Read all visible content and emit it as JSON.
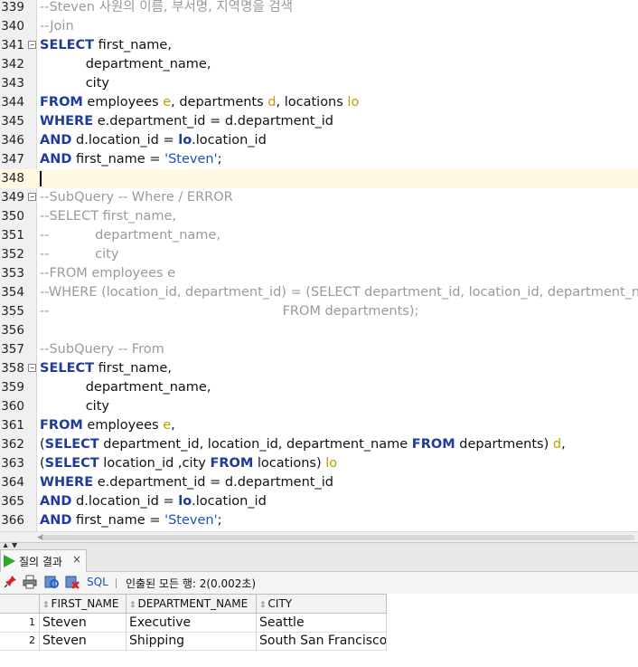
{
  "editor": {
    "lines": [
      {
        "num": "339",
        "fold": false,
        "tokens": [
          {
            "t": "--Steven 사원의 이름, 부서명, 지역명을 검색",
            "c": "cm"
          }
        ]
      },
      {
        "num": "340",
        "fold": false,
        "tokens": [
          {
            "t": "--Join",
            "c": "cm"
          }
        ]
      },
      {
        "num": "341",
        "fold": true,
        "tokens": [
          {
            "t": "SELECT",
            "c": "kw"
          },
          {
            "t": " first_name,",
            "c": ""
          }
        ]
      },
      {
        "num": "342",
        "fold": false,
        "tokens": [
          {
            "t": "           department_name,",
            "c": ""
          }
        ]
      },
      {
        "num": "343",
        "fold": false,
        "tokens": [
          {
            "t": "           city",
            "c": ""
          }
        ]
      },
      {
        "num": "344",
        "fold": false,
        "tokens": [
          {
            "t": "FROM",
            "c": "kw"
          },
          {
            "t": " employees ",
            "c": ""
          },
          {
            "t": "e",
            "c": "al"
          },
          {
            "t": ", departments ",
            "c": ""
          },
          {
            "t": "d",
            "c": "al"
          },
          {
            "t": ", locations ",
            "c": ""
          },
          {
            "t": "lo",
            "c": "al"
          }
        ]
      },
      {
        "num": "345",
        "fold": false,
        "tokens": [
          {
            "t": "WHERE",
            "c": "kw"
          },
          {
            "t": " e.department_id = d.department_id",
            "c": ""
          }
        ]
      },
      {
        "num": "346",
        "fold": false,
        "tokens": [
          {
            "t": "AND",
            "c": "kw"
          },
          {
            "t": " d.location_id = ",
            "c": ""
          },
          {
            "t": "lo",
            "c": "kw"
          },
          {
            "t": ".location_id",
            "c": ""
          }
        ]
      },
      {
        "num": "347",
        "fold": false,
        "tokens": [
          {
            "t": "AND",
            "c": "kw"
          },
          {
            "t": " first_name = ",
            "c": ""
          },
          {
            "t": "'Steven'",
            "c": "str"
          },
          {
            "t": ";",
            "c": ""
          }
        ]
      },
      {
        "num": "348",
        "fold": false,
        "current": true,
        "tokens": []
      },
      {
        "num": "349",
        "fold": true,
        "tokens": [
          {
            "t": "--SubQuery -- Where / ERROR",
            "c": "cm"
          }
        ]
      },
      {
        "num": "350",
        "fold": false,
        "tokens": [
          {
            "t": "--SELECT first_name,",
            "c": "cm"
          }
        ]
      },
      {
        "num": "351",
        "fold": false,
        "tokens": [
          {
            "t": "--           department_name,",
            "c": "cm"
          }
        ]
      },
      {
        "num": "352",
        "fold": false,
        "tokens": [
          {
            "t": "--           city",
            "c": "cm"
          }
        ]
      },
      {
        "num": "353",
        "fold": false,
        "tokens": [
          {
            "t": "--FROM employees e",
            "c": "cm"
          }
        ]
      },
      {
        "num": "354",
        "fold": false,
        "tokens": [
          {
            "t": "--WHERE (location_id, department_id) = (SELECT department_id, location_id, department_name",
            "c": "cm"
          }
        ]
      },
      {
        "num": "355",
        "fold": false,
        "tokens": [
          {
            "t": "--                                                        FROM departments);",
            "c": "cm"
          }
        ]
      },
      {
        "num": "356",
        "fold": false,
        "tokens": []
      },
      {
        "num": "357",
        "fold": false,
        "tokens": [
          {
            "t": "--SubQuery -- From",
            "c": "cm"
          }
        ]
      },
      {
        "num": "358",
        "fold": true,
        "tokens": [
          {
            "t": "SELECT",
            "c": "kw"
          },
          {
            "t": " first_name,",
            "c": ""
          }
        ]
      },
      {
        "num": "359",
        "fold": false,
        "tokens": [
          {
            "t": "           department_name,",
            "c": ""
          }
        ]
      },
      {
        "num": "360",
        "fold": false,
        "tokens": [
          {
            "t": "           city",
            "c": ""
          }
        ]
      },
      {
        "num": "361",
        "fold": false,
        "tokens": [
          {
            "t": "FROM",
            "c": "kw"
          },
          {
            "t": " employees ",
            "c": ""
          },
          {
            "t": "e",
            "c": "al"
          },
          {
            "t": ",",
            "c": ""
          }
        ]
      },
      {
        "num": "362",
        "fold": false,
        "tokens": [
          {
            "t": "(",
            "c": ""
          },
          {
            "t": "SELECT",
            "c": "kw"
          },
          {
            "t": " department_id, location_id, department_name ",
            "c": ""
          },
          {
            "t": "FROM",
            "c": "kw"
          },
          {
            "t": " departments) ",
            "c": ""
          },
          {
            "t": "d",
            "c": "al"
          },
          {
            "t": ",",
            "c": ""
          }
        ]
      },
      {
        "num": "363",
        "fold": false,
        "tokens": [
          {
            "t": "(",
            "c": ""
          },
          {
            "t": "SELECT",
            "c": "kw"
          },
          {
            "t": " location_id ,city ",
            "c": ""
          },
          {
            "t": "FROM",
            "c": "kw"
          },
          {
            "t": " locations) ",
            "c": ""
          },
          {
            "t": "lo",
            "c": "al"
          }
        ]
      },
      {
        "num": "364",
        "fold": false,
        "tokens": [
          {
            "t": "WHERE",
            "c": "kw"
          },
          {
            "t": " e.department_id = d.department_id",
            "c": ""
          }
        ]
      },
      {
        "num": "365",
        "fold": false,
        "tokens": [
          {
            "t": "AND",
            "c": "kw"
          },
          {
            "t": " d.location_id = ",
            "c": ""
          },
          {
            "t": "lo",
            "c": "kw"
          },
          {
            "t": ".location_id",
            "c": ""
          }
        ]
      },
      {
        "num": "366",
        "fold": false,
        "tokens": [
          {
            "t": "AND",
            "c": "kw"
          },
          {
            "t": " first_name = ",
            "c": ""
          },
          {
            "t": "'Steven'",
            "c": "str"
          },
          {
            "t": ";",
            "c": ""
          }
        ]
      }
    ]
  },
  "results": {
    "tab_label": "질의 결과",
    "tab_close": "×",
    "toolbar": {
      "pin_icon": "pin-icon",
      "print_icon": "print-icon",
      "refresh_icon": "refresh-icon",
      "export_icon": "export-icon",
      "sql_label": "SQL",
      "status": "인출된 모든 행: 2(0.002초)"
    },
    "columns": [
      "FIRST_NAME",
      "DEPARTMENT_NAME",
      "CITY"
    ],
    "rows": [
      {
        "rownum": "1",
        "cells": [
          "Steven",
          "Executive",
          "Seattle"
        ]
      },
      {
        "rownum": "2",
        "cells": [
          "Steven",
          "Shipping",
          "South San Francisco"
        ]
      }
    ]
  },
  "colors": {
    "keyword": "#1f3b9c",
    "comment": "#9a9a9a",
    "alias": "#b8a200",
    "string": "#1f4fc0",
    "current_line": "#fff8e3"
  }
}
